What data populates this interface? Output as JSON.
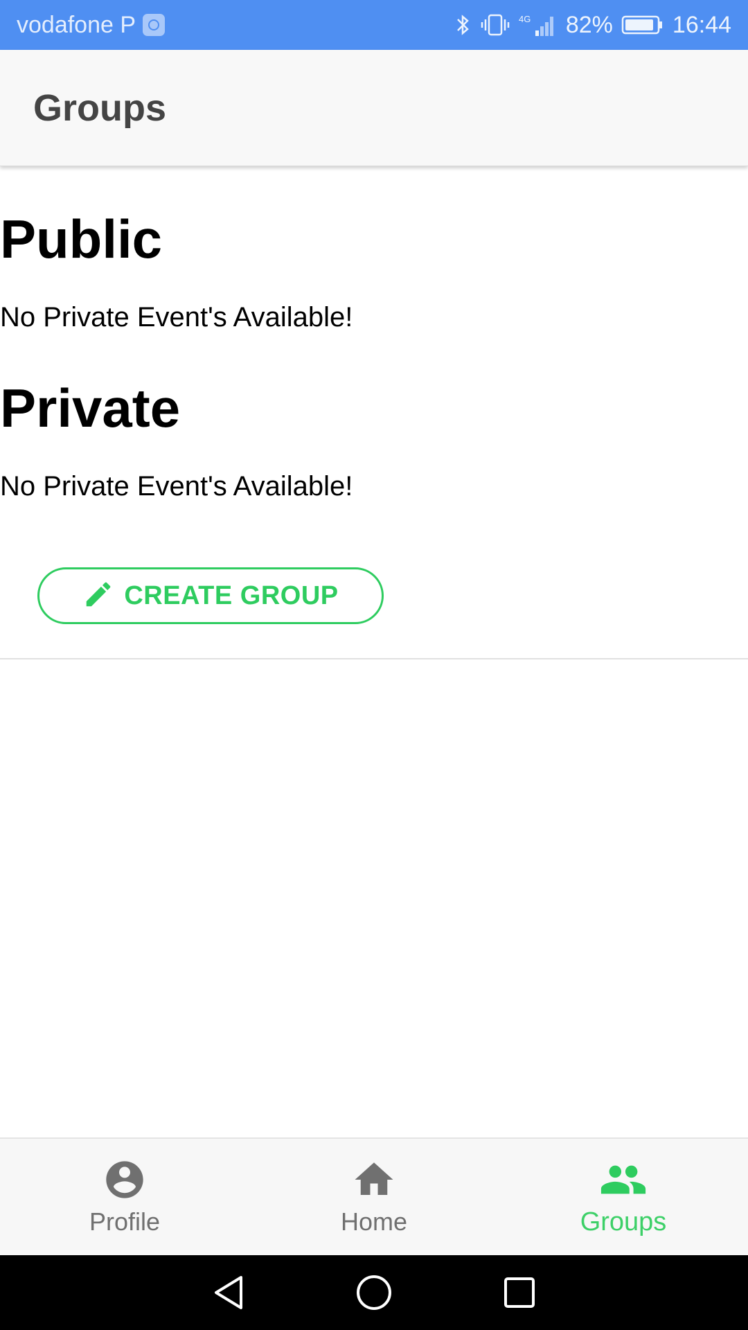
{
  "status_bar": {
    "carrier": "vodafone P",
    "battery_percent": "82%",
    "time": "16:44",
    "network_label": "4G",
    "icons": [
      "carrier-badge-icon",
      "bluetooth-icon",
      "vibrate-icon",
      "signal-icon",
      "battery-icon"
    ]
  },
  "app_bar": {
    "title": "Groups"
  },
  "main": {
    "public_section": {
      "title": "Public",
      "empty_message": "No Private Event's Available!"
    },
    "private_section": {
      "title": "Private",
      "empty_message": "No Private Event's Available!"
    },
    "create_button": {
      "label": "CREATE GROUP",
      "icon": "pencil-icon"
    }
  },
  "bottom_nav": {
    "items": [
      {
        "label": "Profile",
        "icon": "account-circle-icon",
        "active": false
      },
      {
        "label": "Home",
        "icon": "home-icon",
        "active": false
      },
      {
        "label": "Groups",
        "icon": "groups-icon",
        "active": true
      }
    ]
  },
  "system_nav": {
    "buttons": [
      "back-icon",
      "home-circle-icon",
      "recents-icon"
    ]
  },
  "colors": {
    "status_bar": "#4f8ff2",
    "accent_green": "#2ecc5f",
    "inactive_gray": "#707070",
    "app_bar_bg": "#f8f8f8"
  }
}
